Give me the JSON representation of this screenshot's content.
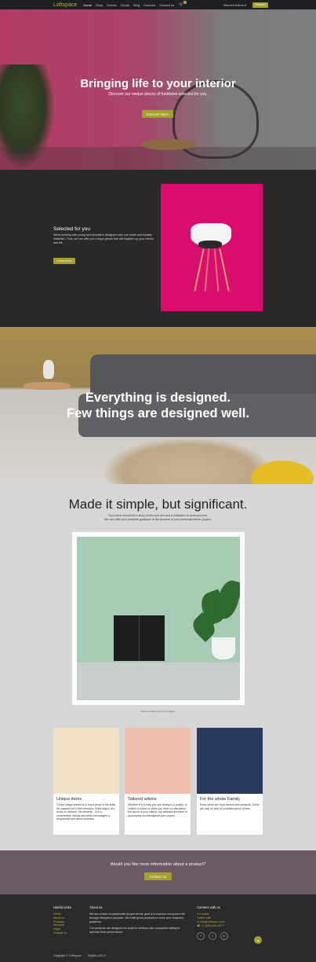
{
  "nav": {
    "brand": "Loftspace",
    "items": [
      "Home",
      "Shop",
      "Events",
      "Forum",
      "Blog",
      "Courses",
      "Contact us"
    ],
    "cart_icon": "cart-icon",
    "user": "Mitchell Admin ▾",
    "redirect_label": "Redirect"
  },
  "hero": {
    "title": "Bringing life to your interior",
    "subtitle": "Discover our unique pieces of furnitures selected for you.",
    "button": "Discover More"
  },
  "selected": {
    "title": "Selected for you",
    "text": "We're working with young and innovative designers who use noble and durable materials. Thus, we can offer you unique pieces that will brighten up your interior and life.",
    "button": "Learn more"
  },
  "banner": {
    "line1": "Everything is designed.",
    "line2": "Few things are designed well."
  },
  "simple": {
    "title": "Made it simple, but significant.",
    "desc1": "Your home should be a story of who you are and a collection of what you love.",
    "desc2": "We can offer you complete guidance in the process of your personal interior project.",
    "caption": "Home is where your story begins."
  },
  "cards": [
    {
      "title": "Unique items",
      "text": "To buy unique pieces is to buy a piece of the artist. His passion put in the execution of the object, his hours of reflexion, his dexterity... It is a commitment, ethical and which encourages a responsible and direct economy.",
      "bg": "#f3e1c6"
    },
    {
      "title": "Tailored advice",
      "text": "Whether it is to help you see clearly in a project, to confirm a choice or when you have no idea about the layout of your interior, our advisers are there to accompany you throughout your project.",
      "bg": "#f0bcab"
    },
    {
      "title": "For the whole Family",
      "text": "Every week our shop receive new products. Some are only on sale for a limited period of time.",
      "bg": "#293a5e"
    }
  ],
  "cta": {
    "question": "Would you like more information about a product?",
    "button": "Contact us"
  },
  "footer": {
    "useful_title": "Useful Links",
    "links": [
      "Home",
      "About us",
      "Products",
      "Services",
      "Legal",
      "Contact us"
    ],
    "about_title": "About us",
    "about_p1": "We are a team of passionate people whose goal is to improve everyone's life through disruptive products. We build great products to solve your business problems.",
    "about_p2": "Our products are designed for small to medium size companies willing to optimize their performance.",
    "connect_title": "Connect with us",
    "contact": "Contact",
    "twitter": "Twitter edit",
    "email": "info@loftspace.com",
    "phone": "+1 (650) 691-3277",
    "copyright": "Copyright © Loftspace",
    "language": "English (US) ▾"
  },
  "colors": {
    "accent": "#a2a12b",
    "hero_pink": "#b43d67",
    "dark": "#29292c",
    "cta": "#6b5a66"
  }
}
